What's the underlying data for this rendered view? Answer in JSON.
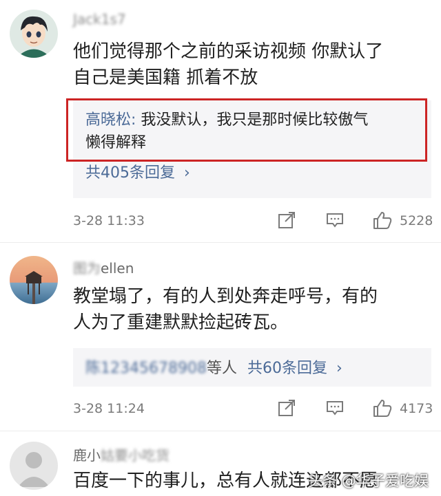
{
  "comments": [
    {
      "username": "Jack1s7",
      "body_line1": "他们觉得那个之前的采访视频 你默认了",
      "body_line2": "自己是美国籍 抓着不放",
      "reply": {
        "name": "高晓松",
        "colon": ": ",
        "text_line1": "我没默认，我只是那时候比较傲气",
        "text_line2": "懒得解释"
      },
      "reply_count": "共405条回复",
      "time": "3-28 11:33",
      "likes": "5228"
    },
    {
      "username_blur": "图为",
      "username_clear": "ellen",
      "body_line1": "教堂塌了，有的人到处奔走呼号，有的",
      "body_line2": "人为了重建默默捡起砖瓦。",
      "reply_prefix": "陈12345678908",
      "reply_others": "等人",
      "reply_count": "共60条回复",
      "time": "3-28 11:24",
      "likes": "4173"
    },
    {
      "username_clear": "鹿小",
      "username_blur": "姑要小吃货",
      "body_line1": "百度一下的事儿，总有人就连这都不愿"
    }
  ],
  "chevron": "›",
  "watermark": "头条 @华子爱吃娱"
}
